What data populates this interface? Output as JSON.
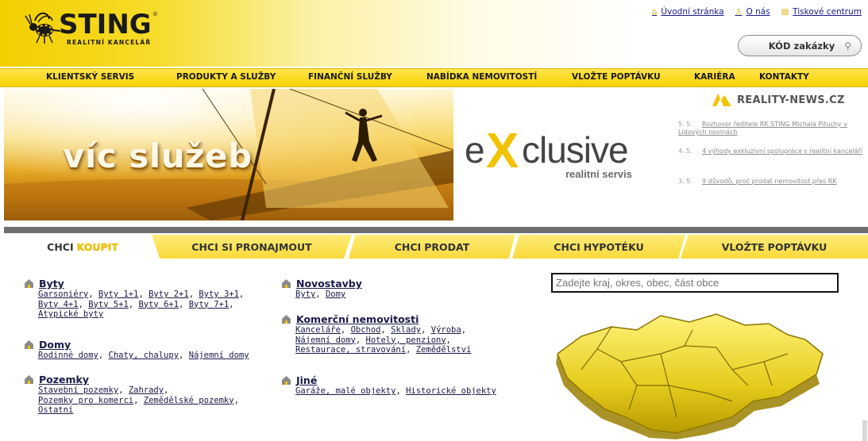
{
  "brand": {
    "name": "STING",
    "tagline": "REALITNÍ KANCELÁŘ",
    "registered_mark": "®",
    "accent_color": "#f2c300"
  },
  "top_links": [
    {
      "label": "Úvodní stránka",
      "icon": "home-icon"
    },
    {
      "label": "O nás",
      "icon": "person-icon"
    },
    {
      "label": "Tiskové centrum",
      "icon": "document-icon"
    }
  ],
  "search_code": {
    "label": "KÓD zakázky",
    "icon": "search-icon"
  },
  "nav": [
    "KLIENTSKÝ SERVIS",
    "PRODUKTY A SLUŽBY",
    "FINANČNÍ SLUŽBY",
    "NABÍDKA NEMOVITOSTÍ",
    "VLOŽTE POPTÁVKU",
    "KARIÉRA",
    "KONTAKTY"
  ],
  "banner": {
    "slogan": "víc služeb",
    "exclusive_word": "clusive",
    "exclusive_prefix": "e",
    "exclusive_x": "X",
    "exclusive_sub": "realitní servis"
  },
  "news": {
    "title": "REALITY-NEWS.CZ",
    "items": [
      {
        "date": "5. 5.",
        "text": "Rozhovor ředitele RK STING Michala Pituchy v Lidových novinách"
      },
      {
        "date": "4. 5.",
        "text": "4 výhody exkluzivní spolupráce s realitní kanceláří"
      },
      {
        "date": "3. 5.",
        "text": "9 důvodů, proč prodat nemovitost přes RK"
      }
    ]
  },
  "tabs": [
    {
      "prefix": "CHCI",
      "highlight": "KOUPIT",
      "active": true
    },
    {
      "prefix": "CHCI SI",
      "highlight": "PRONAJMOUT",
      "active": false
    },
    {
      "prefix": "CHCI",
      "highlight": "PRODAT",
      "active": false
    },
    {
      "prefix": "CHCI",
      "highlight": "HYPOTÉKU",
      "active": false
    },
    {
      "prefix": "VLOŽTE",
      "highlight": "POPTÁVKU",
      "active": false
    }
  ],
  "categories_left": [
    {
      "title": "Byty",
      "lines": [
        [
          "Garsoniéry",
          "Byty 1+1",
          "Byty 2+1",
          "Byty 3+1"
        ],
        [
          "Byty 4+1",
          "Byty 5+1",
          "Byty 6+1",
          "Byty 7+1"
        ],
        [
          "Atypické byty"
        ]
      ]
    },
    {
      "title": "Domy",
      "lines": [
        [
          "Rodinné domy",
          "Chaty, chalupy",
          "Nájemní domy"
        ]
      ]
    },
    {
      "title": "Pozemky",
      "lines": [
        [
          "Stavební pozemky",
          "Zahrady"
        ],
        [
          "Pozemky pro komerci",
          "Zemědělské pozemky"
        ],
        [
          "Ostatní"
        ]
      ]
    }
  ],
  "categories_right": [
    {
      "title": "Novostavby",
      "lines": [
        [
          "Byty",
          "Domy"
        ]
      ]
    },
    {
      "title": "Komerční nemovitosti",
      "lines": [
        [
          "Kanceláře",
          "Obchod",
          "Sklady",
          "Výroba"
        ],
        [
          "Nájemní domy",
          "Hotely, penziony"
        ],
        [
          "Restaurace, stravování",
          "Zemědělství"
        ]
      ]
    },
    {
      "title": "Jiné",
      "lines": [
        [
          "Garáže, malé objekty",
          "Historické objekty"
        ]
      ]
    }
  ],
  "map_search": {
    "placeholder": "Zadejte kraj, okres, obec, část obce"
  }
}
